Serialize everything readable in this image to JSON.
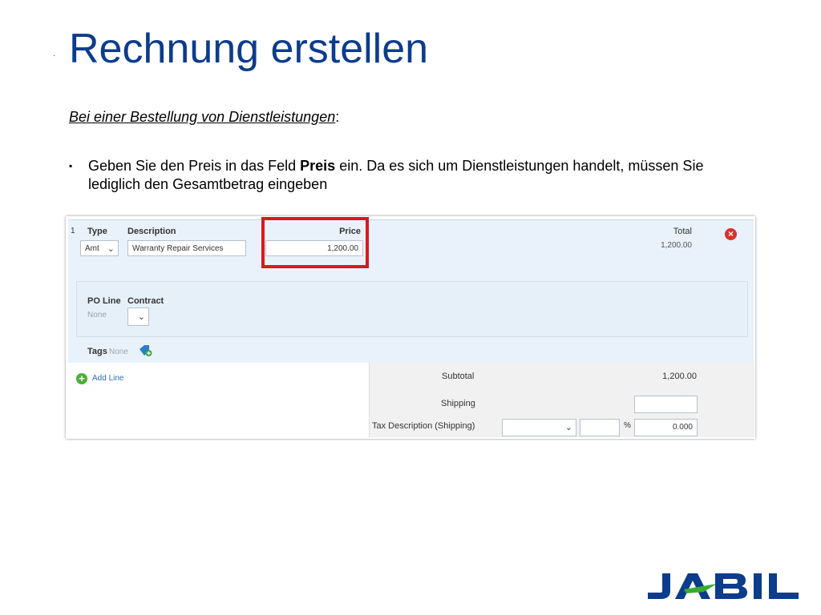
{
  "slide": {
    "dot": "·",
    "title": "Rechnung erstellen",
    "subheading": "Bei einer Bestellung von Dienstleistungen",
    "subheading_suffix": ":",
    "bullet_marker": "▪",
    "bullet_part1": "Geben Sie den Preis in das Feld ",
    "bullet_bold": "Preis",
    "bullet_part2": " ein. Da es sich um Dienstleistungen handelt, müssen Sie lediglich den Gesamtbetrag eingeben"
  },
  "invoice": {
    "line_number": "1",
    "type_label": "Type",
    "type_value": "Amt",
    "description_label": "Description",
    "description_value": "Warranty Repair Services",
    "price_label": "Price",
    "price_value": "1,200.00",
    "total_label": "Total",
    "total_value": "1,200.00",
    "remove_icon": "×",
    "po_line_label": "PO Line",
    "po_line_value": "None",
    "contract_label": "Contract",
    "tags_label": "Tags",
    "tags_value": "None",
    "add_line": "Add Line",
    "subtotal_label": "Subtotal",
    "subtotal_value": "1,200.00",
    "shipping_label": "Shipping",
    "shipping_value": "",
    "tax_description_label": "Tax Description (Shipping)",
    "tax_percent_symbol": "%",
    "tax_amount": "0.000"
  },
  "logo": {
    "text": "JABIL",
    "color": "#0c3c8c",
    "accent": "#3aaa35"
  },
  "colors": {
    "title": "#0c3c8c",
    "highlight": "#e0161b",
    "panel": "#e9f2fa"
  }
}
